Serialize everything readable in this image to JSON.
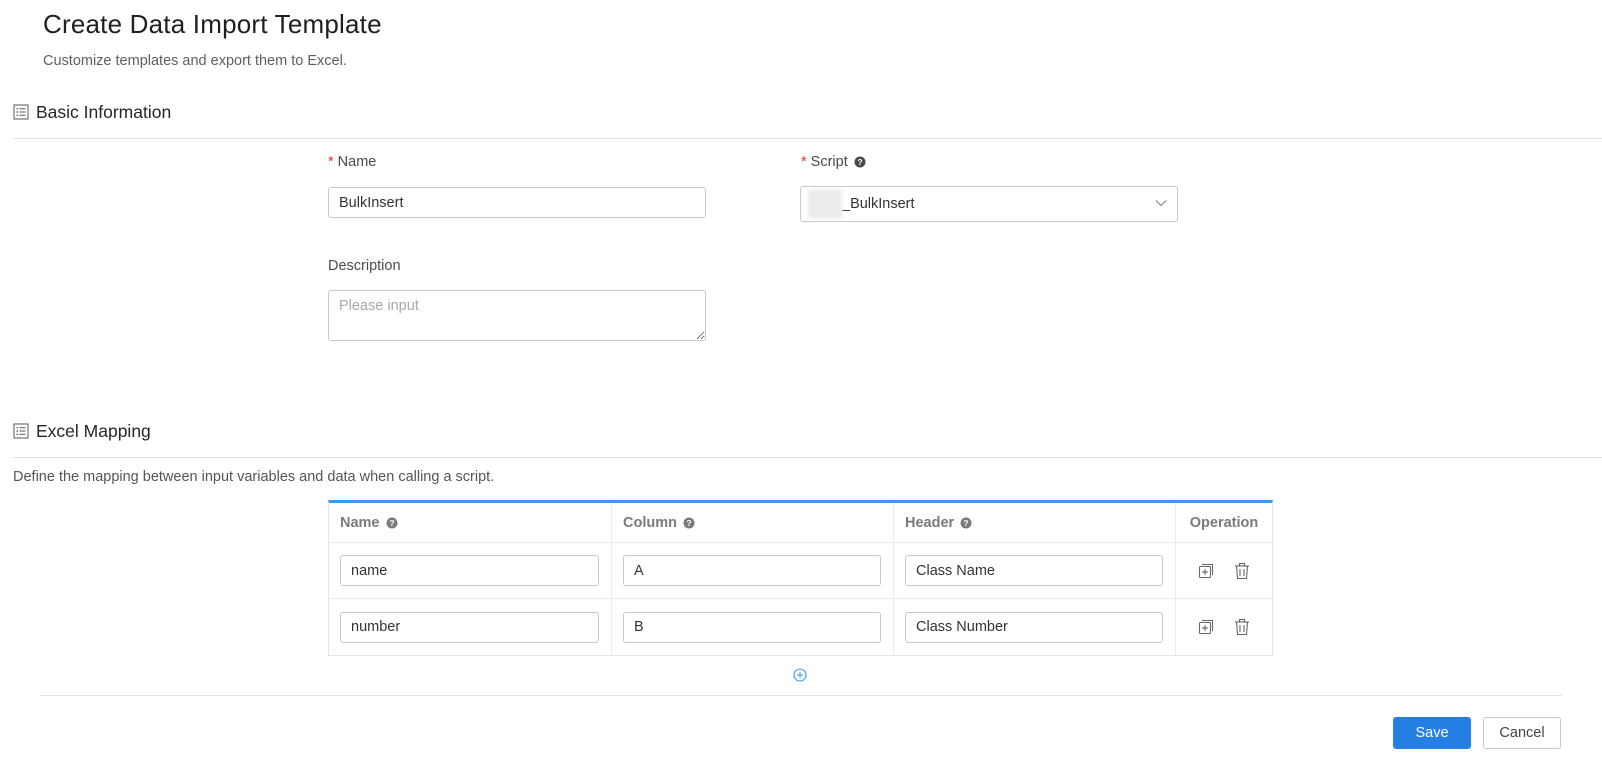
{
  "header": {
    "title": "Create Data Import Template",
    "subtitle": "Customize templates and export them to Excel."
  },
  "basic_info": {
    "title": "Basic Information",
    "name_label": "Name",
    "name_value": "BulkInsert",
    "script_label": "Script",
    "script_value": "_BulkInsert",
    "description_label": "Description",
    "description_value": "",
    "description_placeholder": "Please input",
    "required_mark": "*"
  },
  "excel_mapping": {
    "title": "Excel Mapping",
    "description": "Define the mapping between input variables and data when calling a script.",
    "columns": [
      "Name",
      "Column",
      "Header",
      "Operation"
    ],
    "rows": [
      {
        "name": "name",
        "column": "A",
        "header": "Class Name"
      },
      {
        "name": "number",
        "column": "B",
        "header": "Class Number"
      }
    ]
  },
  "footer": {
    "save_label": "Save",
    "cancel_label": "Cancel"
  },
  "colors": {
    "accent": "#2680e3",
    "table_top_border": "#3a9be8",
    "required": "#e0353a"
  },
  "icons": [
    "list-icon",
    "help-icon",
    "chevron-down-icon",
    "add-row-icon",
    "delete-icon",
    "plus-circle-icon"
  ]
}
